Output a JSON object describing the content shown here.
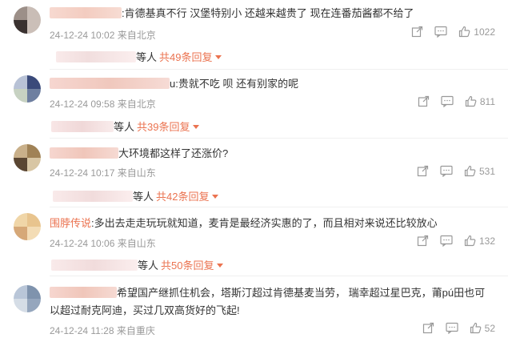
{
  "comments": [
    {
      "text": ":肯德基真不行  汉堡特别小  还越来越贵了  现在连番茄酱都不给了",
      "time": "24-12-24 10:02",
      "location": "来自北京",
      "likes": "1022",
      "reply_suffix": "等人",
      "reply_count": "共49条回复"
    },
    {
      "text": "u:贵就不吃 呗 还有别家的呢",
      "time": "24-12-24 09:58",
      "location": "来自北京",
      "likes": "811",
      "reply_suffix": "等人",
      "reply_count": "共39条回复"
    },
    {
      "text": "大环境都这样了还涨价?",
      "time": "24-12-24 10:17",
      "location": "来自山东",
      "likes": "531",
      "reply_suffix": "等人",
      "reply_count": "共42条回复"
    },
    {
      "username": "围脖传说",
      "text": ":多出去走走玩玩就知道，麦肯是最经济实惠的了，而且相对来说还比较放心",
      "time": "24-12-24 10:06",
      "location": "来自山东",
      "likes": "132",
      "reply_suffix": "等人",
      "reply_count": "共50条回复"
    },
    {
      "text_line1": "希望国产继抓住机会，塔斯汀超过肯德基麦当劳， 瑞幸超过星巴克，莆pú田也可",
      "text_line2": "以超过耐克阿迪，买过几双高货好的飞起!",
      "time": "24-12-24 11:28",
      "location": "来自重庆",
      "likes": "52"
    }
  ],
  "colors": {
    "accent": "#eb7350",
    "meta": "#999999",
    "text": "#333333"
  }
}
